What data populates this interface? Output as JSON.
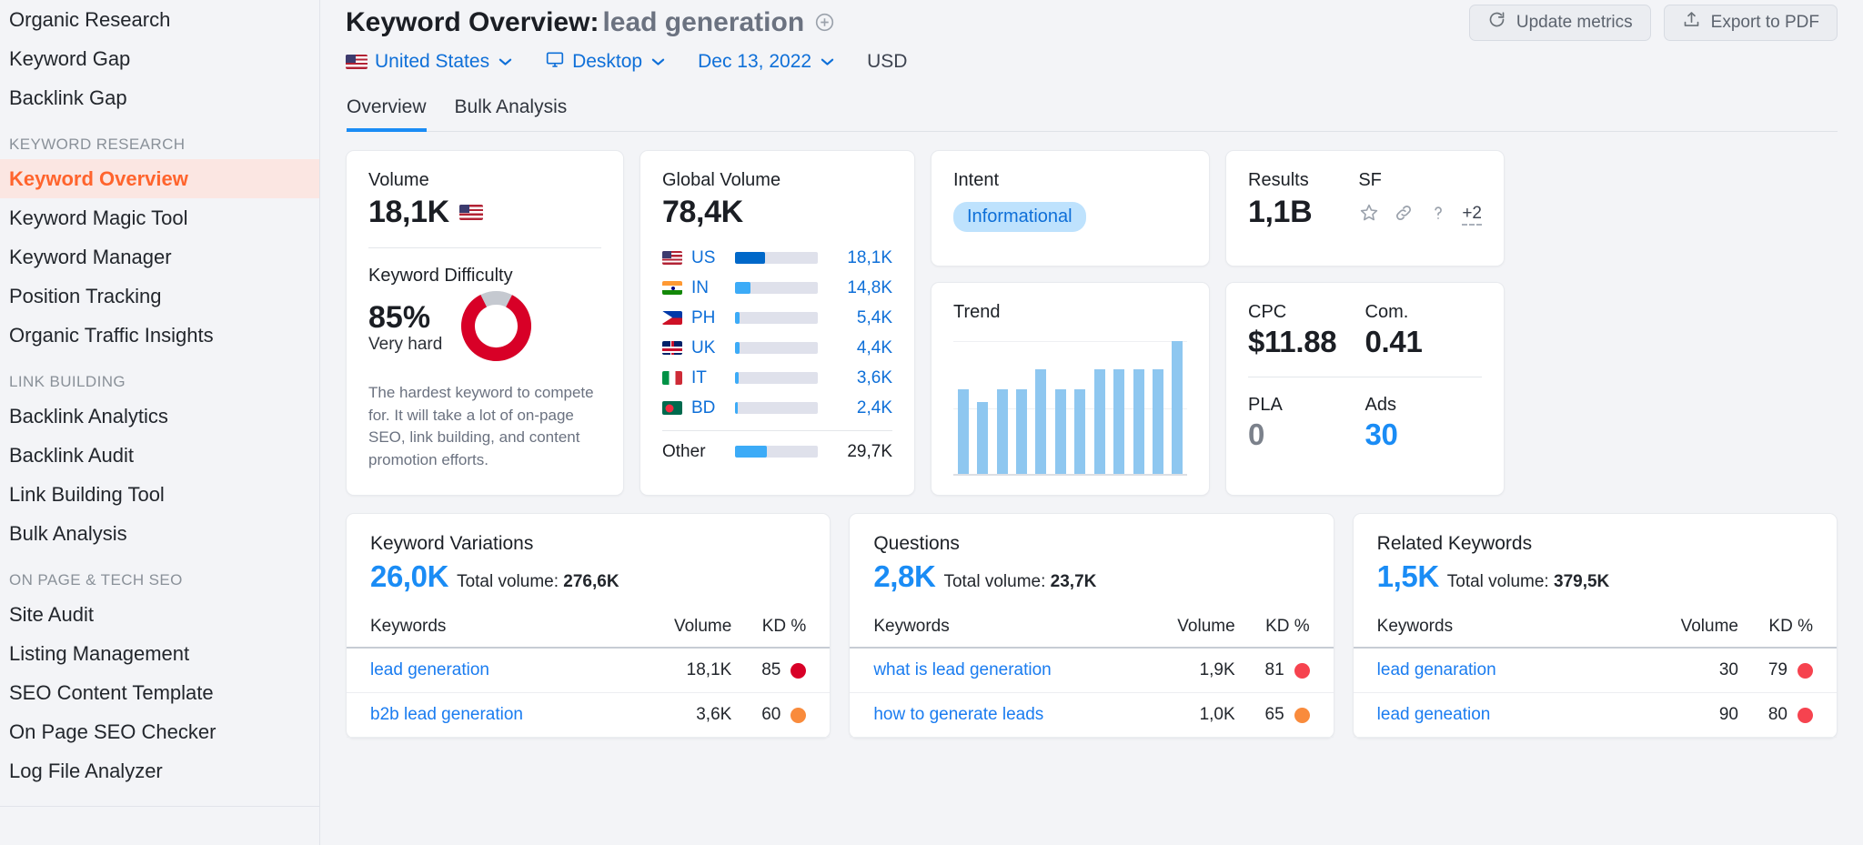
{
  "sidebar": {
    "top_items": [
      {
        "label": "Organic Research"
      },
      {
        "label": "Keyword Gap"
      },
      {
        "label": "Backlink Gap"
      }
    ],
    "sections": [
      {
        "title": "KEYWORD RESEARCH",
        "items": [
          {
            "label": "Keyword Overview",
            "active": true
          },
          {
            "label": "Keyword Magic Tool",
            "active": false
          },
          {
            "label": "Keyword Manager",
            "active": false
          },
          {
            "label": "Position Tracking",
            "active": false
          },
          {
            "label": "Organic Traffic Insights",
            "active": false
          }
        ]
      },
      {
        "title": "LINK BUILDING",
        "items": [
          {
            "label": "Backlink Analytics",
            "active": false
          },
          {
            "label": "Backlink Audit",
            "active": false
          },
          {
            "label": "Link Building Tool",
            "active": false
          },
          {
            "label": "Bulk Analysis",
            "active": false
          }
        ]
      },
      {
        "title": "ON PAGE & TECH SEO",
        "items": [
          {
            "label": "Site Audit",
            "active": false
          },
          {
            "label": "Listing Management",
            "active": false
          },
          {
            "label": "SEO Content Template",
            "active": false
          },
          {
            "label": "On Page SEO Checker",
            "active": false
          },
          {
            "label": "Log File Analyzer",
            "active": false
          }
        ]
      }
    ]
  },
  "header": {
    "title_prefix": "Keyword Overview:",
    "keyword": "lead generation",
    "add_icon": "plus-circle-icon",
    "update_metrics_label": "Update metrics",
    "export_pdf_label": "Export to PDF",
    "filters": {
      "country": "United States",
      "country_flag": "us-flag-icon",
      "device": "Desktop",
      "device_icon": "monitor-icon",
      "date": "Dec 13, 2022",
      "currency": "USD"
    },
    "tabs": [
      {
        "label": "Overview",
        "active": true
      },
      {
        "label": "Bulk Analysis",
        "active": false
      }
    ]
  },
  "volume_card": {
    "label": "Volume",
    "value": "18,1K",
    "flag": "us-flag-icon",
    "kd_label": "Keyword Difficulty",
    "kd_value": "85%",
    "kd_percent": 85,
    "kd_level": "Very hard",
    "kd_description": "The hardest keyword to compete for. It will take a lot of on-page SEO, link building, and content promotion efforts.",
    "kd_color": "#d80027",
    "kd_track_color": "#c5c9d0"
  },
  "global_volume": {
    "label": "Global Volume",
    "value": "78,4K",
    "bar_color_primary": "#0068c9",
    "bar_color_secondary": "#3cabf7",
    "bar_track_color": "#dfe1eb",
    "rows": [
      {
        "code": "US",
        "flag": "f-us",
        "value": "18,1K",
        "pct": 36,
        "primary": true
      },
      {
        "code": "IN",
        "flag": "f-in",
        "value": "14,8K",
        "pct": 19,
        "primary": false
      },
      {
        "code": "PH",
        "flag": "f-ph",
        "value": "5,4K",
        "pct": 6,
        "primary": false
      },
      {
        "code": "UK",
        "flag": "f-uk",
        "value": "4,4K",
        "pct": 5,
        "primary": false
      },
      {
        "code": "IT",
        "flag": "f-it",
        "value": "3,6K",
        "pct": 4,
        "primary": false
      },
      {
        "code": "BD",
        "flag": "f-bd",
        "value": "2,4K",
        "pct": 3,
        "primary": false
      }
    ],
    "other": {
      "label": "Other",
      "value": "29,7K",
      "pct": 38
    }
  },
  "intent_card": {
    "label": "Intent",
    "value": "Informational"
  },
  "results_card": {
    "results_label": "Results",
    "results_value": "1,1B",
    "sf_label": "SF",
    "sf_icons": [
      "star-icon",
      "link-icon",
      "question-icon"
    ],
    "sf_more": "+2"
  },
  "trend_card": {
    "label": "Trend"
  },
  "cpc_card": {
    "cpc_label": "CPC",
    "cpc_value": "$11.88",
    "com_label": "Com.",
    "com_value": "0.41",
    "pla_label": "PLA",
    "pla_value": "0",
    "ads_label": "Ads",
    "ads_value": "30"
  },
  "tables": [
    {
      "title": "Keyword Variations",
      "count": "26,0K",
      "total_prefix": "Total volume:",
      "total_value": "276,6K",
      "columns": {
        "keywords": "Keywords",
        "volume": "Volume",
        "kd": "KD %"
      },
      "rows": [
        {
          "keyword": "lead generation",
          "volume": "18,1K",
          "kd": "85",
          "dot": "#d80027"
        },
        {
          "keyword": "b2b lead generation",
          "volume": "3,6K",
          "kd": "60",
          "dot": "#f98b3c"
        }
      ]
    },
    {
      "title": "Questions",
      "count": "2,8K",
      "total_prefix": "Total volume:",
      "total_value": "23,7K",
      "columns": {
        "keywords": "Keywords",
        "volume": "Volume",
        "kd": "KD %"
      },
      "rows": [
        {
          "keyword": "what is lead generation",
          "volume": "1,9K",
          "kd": "81",
          "dot": "#f6434f"
        },
        {
          "keyword": "how to generate leads",
          "volume": "1,0K",
          "kd": "65",
          "dot": "#f98b3c"
        }
      ]
    },
    {
      "title": "Related Keywords",
      "count": "1,5K",
      "total_prefix": "Total volume:",
      "total_value": "379,5K",
      "columns": {
        "keywords": "Keywords",
        "volume": "Volume",
        "kd": "KD %"
      },
      "rows": [
        {
          "keyword": "lead genaration",
          "volume": "30",
          "kd": "79",
          "dot": "#f6434f"
        },
        {
          "keyword": "lead geneation",
          "volume": "90",
          "kd": "80",
          "dot": "#f6434f"
        }
      ]
    }
  ],
  "chart_data": {
    "type": "bar",
    "title": "Trend",
    "categories": [
      "1",
      "2",
      "3",
      "4",
      "5",
      "6",
      "7",
      "8",
      "9",
      "10",
      "11",
      "12"
    ],
    "values": [
      64,
      54,
      64,
      64,
      79,
      64,
      64,
      79,
      79,
      79,
      79,
      100
    ],
    "xlabel": "",
    "ylabel": "",
    "ylim": [
      0,
      100
    ],
    "grid": true,
    "legend": false,
    "bar_color": "#8ec7f0"
  }
}
